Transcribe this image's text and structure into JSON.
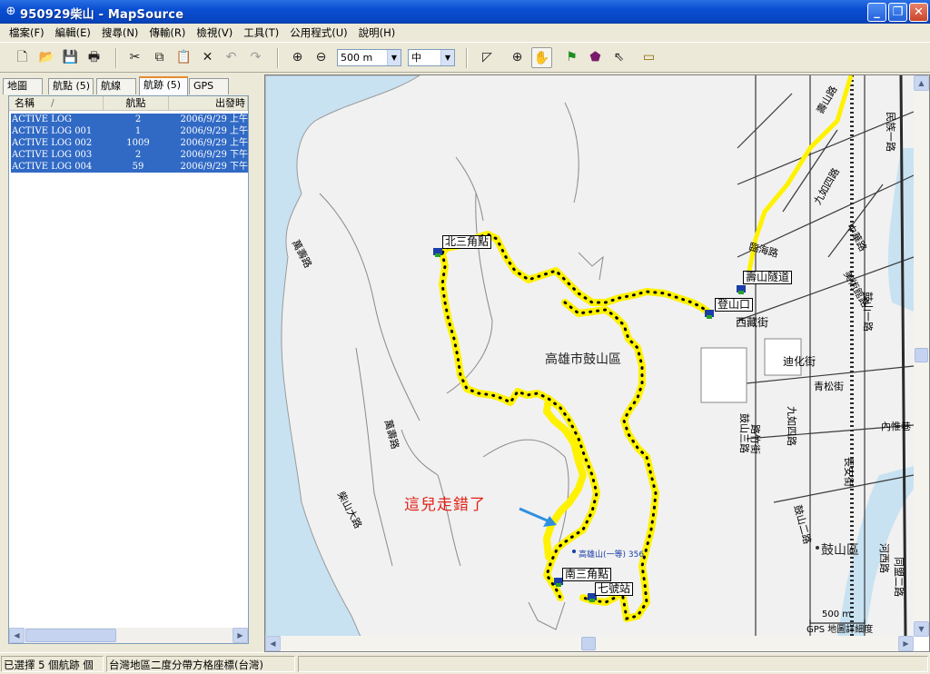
{
  "window": {
    "title": "950929柴山 - MapSource",
    "minimize": "_",
    "maximize": "❐",
    "close": "✕"
  },
  "menu": [
    "檔案(F)",
    "編輯(E)",
    "搜尋(N)",
    "傳輸(R)",
    "檢視(V)",
    "工具(T)",
    "公用程式(U)",
    "說明(H)"
  ],
  "toolbar": {
    "zoom_select": "500 m",
    "detail_select": "中",
    "icons": [
      "new-file-icon",
      "open-folder-icon",
      "save-icon",
      "print-icon",
      "cut-icon",
      "copy-icon",
      "paste-icon",
      "delete-icon",
      "undo-icon",
      "redo-icon",
      "zoom-in-icon",
      "zoom-out-icon",
      "selection-tool-icon",
      "zoom-tool-icon",
      "hand-pan-icon",
      "waypoint-flag-icon",
      "route-tool-icon",
      "pointer-tool-icon",
      "measure-ruler-icon"
    ]
  },
  "tabs": [
    "地圖",
    "航點 (5)",
    "航線",
    "航跡 (5)",
    "GPS"
  ],
  "track_table": {
    "columns": [
      "名稱",
      "航點",
      "出發時"
    ],
    "sort_indicator": "/",
    "rows": [
      {
        "name": "ACTIVE LOG",
        "points": "2",
        "start": "2006/9/29 上午"
      },
      {
        "name": "ACTIVE LOG 001",
        "points": "1",
        "start": "2006/9/29 上午"
      },
      {
        "name": "ACTIVE LOG 002",
        "points": "1009",
        "start": "2006/9/29 上午"
      },
      {
        "name": "ACTIVE LOG 003",
        "points": "2",
        "start": "2006/9/29 下午"
      },
      {
        "name": "ACTIVE LOG 004",
        "points": "59",
        "start": "2006/9/29 下午"
      }
    ]
  },
  "map": {
    "waypoints": [
      "北三角點",
      "南三角點",
      "七號站",
      "登山口",
      "壽山隧道"
    ],
    "annotation": "這兒走錯了",
    "district_label": "高雄市鼓山區",
    "peak_label": "高雄山(一等) 356",
    "roads": [
      "萬壽路",
      "柴山大路",
      "萬壽路",
      "鼓山二路",
      "鼓山三路",
      "九如四路",
      "九如四路",
      "西藏街",
      "迪化街",
      "青松街",
      "內惟巷",
      "壽山路",
      "臨海路",
      "美術館路",
      "鼓山一路",
      "河西路",
      "中華路",
      "同盟二路",
      "民族一路",
      "長安街",
      "路竹街"
    ],
    "area_labels": [
      "鼓山區"
    ],
    "scale_text": "500 m",
    "detail_text": "GPS 地圖詳細度",
    "colors": {
      "land": "#f1f1f1",
      "water": "#c8e2f2",
      "track": "#fff200",
      "annotation": "#e2231a",
      "arrow": "#2f8fe0",
      "selection": "#316ac5"
    }
  },
  "status": {
    "selection": "已選擇 5 個航跡 個",
    "coord_system": "台灣地區二度分帶方格座標(台灣)"
  }
}
